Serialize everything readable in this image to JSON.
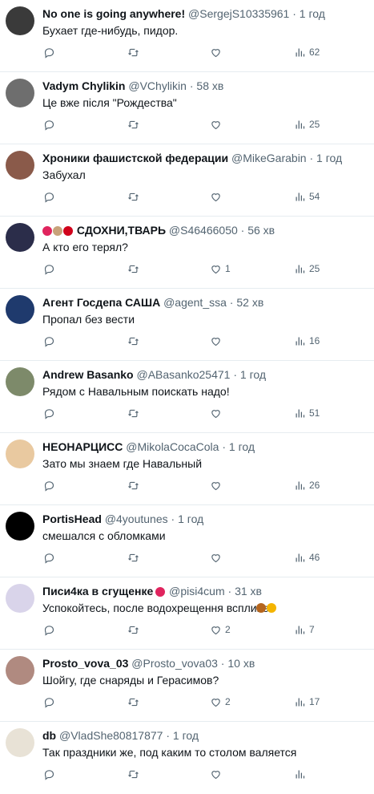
{
  "tweets": [
    {
      "name": "No one is going anywhere!",
      "handle": "@SergejS10335961",
      "time": "1 год",
      "text": "Бухает где-нибудь, пидор.",
      "counts": {
        "reply": "",
        "retweet": "",
        "like": "",
        "views": "62"
      },
      "avatar_color": "#3a3a3a"
    },
    {
      "name": "Vadym Chylikin",
      "handle": "@VChylikin",
      "time": "58 хв",
      "text": "Це вже після \"Рождества\"",
      "counts": {
        "reply": "",
        "retweet": "",
        "like": "",
        "views": "25"
      },
      "avatar_color": "#6e6e6e"
    },
    {
      "name": "Хроники фашистской федерации",
      "handle": "@MikeGarabin",
      "time": "1 год",
      "text": "Забухал",
      "counts": {
        "reply": "",
        "retweet": "",
        "like": "",
        "views": "54"
      },
      "avatar_color": "#8a5a4a"
    },
    {
      "name": "СДОХНИ,ТВАРЬ",
      "handle": "@S46466050",
      "time": "56 хв",
      "text": "А кто его терял?",
      "counts": {
        "reply": "",
        "retweet": "",
        "like": "1",
        "views": "25"
      },
      "avatar_color": "#2b2d4a"
    },
    {
      "name": "Агент Госдепа САША",
      "handle": "@agent_ssa",
      "time": "52 хв",
      "text": "Пропал без вести",
      "counts": {
        "reply": "",
        "retweet": "",
        "like": "",
        "views": "16"
      },
      "avatar_color": "#1f3a6d"
    },
    {
      "name": "Andrew Basanko",
      "handle": "@ABasanko25471",
      "time": "1 год",
      "text": "Рядом с Навальным поискать надо!",
      "counts": {
        "reply": "",
        "retweet": "",
        "like": "",
        "views": "51"
      },
      "avatar_color": "#7d8a6a"
    },
    {
      "name": "НЕОНАРЦИСС",
      "handle": "@MikolaCocaCola",
      "time": "1 год",
      "text": "Зато мы знаем где Навальный",
      "counts": {
        "reply": "",
        "retweet": "",
        "like": "",
        "views": "26"
      },
      "avatar_color": "#e9c9a0"
    },
    {
      "name": "PortisHead",
      "handle": "@4youtunes",
      "time": "1 год",
      "text": "смешался с обломками",
      "counts": {
        "reply": "",
        "retweet": "",
        "like": "",
        "views": "46"
      },
      "avatar_color": "#000000"
    },
    {
      "name": "Писи4ка в сгущенке",
      "handle": "@pisi4cum",
      "time": "31 хв",
      "text": "Успокойтесь, после водохрещення вспливе",
      "counts": {
        "reply": "",
        "retweet": "",
        "like": "2",
        "views": "7"
      },
      "avatar_color": "#d9d4ea"
    },
    {
      "name": "Prosto_vova_03",
      "handle": "@Prosto_vova03",
      "time": "10 хв",
      "text": "Шойгу, где снаряды и Герасимов?",
      "counts": {
        "reply": "",
        "retweet": "",
        "like": "2",
        "views": "17"
      },
      "avatar_color": "#b08a80"
    },
    {
      "name": "db",
      "handle": "@VladShe80817877",
      "time": "1 год",
      "text": "Так праздники же, под каким то столом валяется",
      "counts": {
        "reply": "",
        "retweet": "",
        "like": "",
        "views": ""
      },
      "avatar_color": "#e8e2d6"
    }
  ],
  "icons": {
    "reply": "reply-icon",
    "retweet": "retweet-icon",
    "like": "like-icon",
    "views": "views-icon"
  },
  "colors": {
    "text": "#0f1419",
    "secondary": "#536471",
    "divider": "#e6ecf0"
  }
}
